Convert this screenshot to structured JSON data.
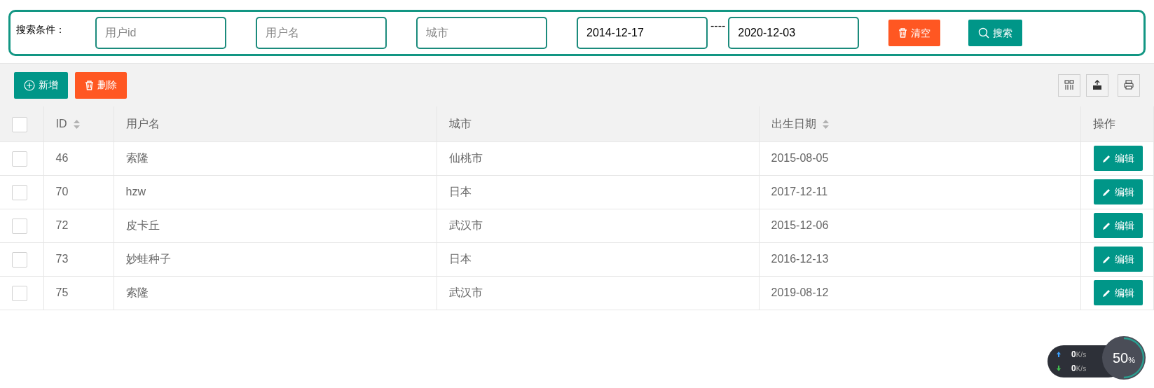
{
  "search": {
    "label": "搜索条件：",
    "fields": [
      {
        "placeholder": "用户id"
      },
      {
        "placeholder": "用户名"
      },
      {
        "placeholder": "城市"
      },
      {
        "value": "2014-12-17"
      },
      {
        "value": "2020-12-03"
      }
    ],
    "separator": "----",
    "buttons": [
      {
        "kind": "clear",
        "label": "清空"
      },
      {
        "kind": "search",
        "label": "搜索"
      }
    ]
  },
  "toolbar": {
    "buttons": [
      {
        "kind": "add",
        "label": "新增"
      },
      {
        "kind": "delete",
        "label": "删除"
      }
    ]
  },
  "table": {
    "select_all": {
      "checked": false
    },
    "columns": [
      {
        "label": "ID",
        "sortable": true
      },
      {
        "label": "用户名",
        "sortable": false
      },
      {
        "label": "城市",
        "sortable": false
      },
      {
        "label": "出生日期",
        "sortable": true
      },
      {
        "label": "操作",
        "sortable": false
      }
    ],
    "rows": [
      {
        "checked": false,
        "cells": [
          "46",
          "索隆",
          "仙桃市",
          "2015-08-05"
        ],
        "action": "编辑"
      },
      {
        "checked": false,
        "cells": [
          "70",
          "hzw",
          "日本",
          "2017-12-11"
        ],
        "action": "编辑"
      },
      {
        "checked": false,
        "cells": [
          "72",
          "皮卡丘",
          "武汉市",
          "2015-12-06"
        ],
        "action": "编辑"
      },
      {
        "checked": false,
        "cells": [
          "73",
          "妙蛙种子",
          "日本",
          "2016-12-13"
        ],
        "action": "编辑"
      },
      {
        "checked": false,
        "cells": [
          "75",
          "索隆",
          "武汉市",
          "2019-08-12"
        ],
        "action": "编辑"
      }
    ]
  },
  "net_widget": {
    "upload": {
      "value": "0",
      "unit": "K/s"
    },
    "download": {
      "value": "0",
      "unit": "K/s"
    },
    "gauge": {
      "value": "50",
      "unit": "%",
      "level": 0.5
    }
  }
}
